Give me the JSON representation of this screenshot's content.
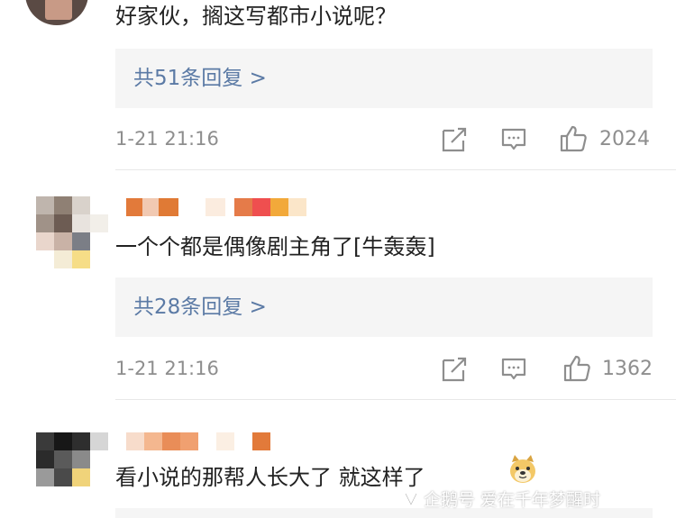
{
  "colors": {
    "background": "#ffffff",
    "reply_box_bg": "#f5f5f5",
    "reply_link": "#5b7aa5",
    "meta_text": "#8e8e8e",
    "divider": "#e8e8e8"
  },
  "comments": [
    {
      "text": "好家伙，搁这写都市小说呢？",
      "replies_label": "共51条回复 >",
      "time": "1-21 21:16",
      "likes": "2024"
    },
    {
      "text": "一个个都是偶像剧主角了[牛轰轰]",
      "replies_label": "共28条回复 >",
      "time": "1-21 21:16",
      "likes": "1362"
    },
    {
      "text": "看小说的那帮人长大了 就这样了",
      "emoji_icon": "doge-emoji-icon"
    }
  ],
  "watermark": {
    "text": "企鹅号 爱在千年梦醒时"
  },
  "icons": {
    "share": "share-icon",
    "comment": "comment-icon",
    "like": "thumbs-up-icon"
  }
}
